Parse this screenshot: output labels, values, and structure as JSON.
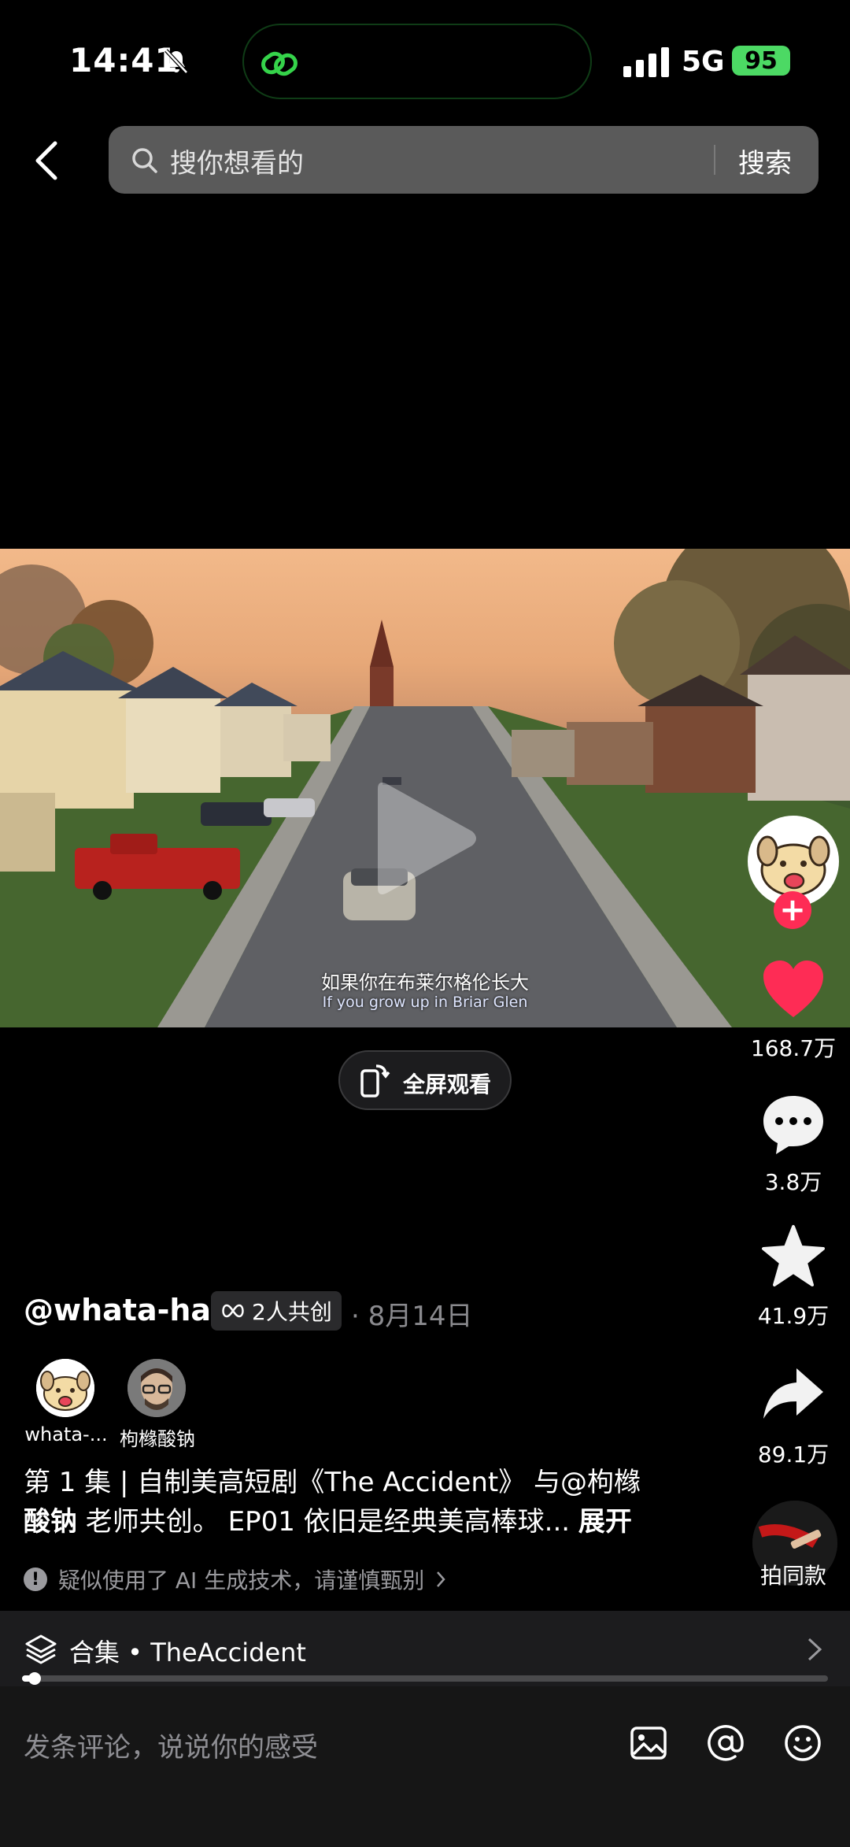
{
  "status_bar": {
    "time": "14:41",
    "network": "5G",
    "battery": "95"
  },
  "search": {
    "placeholder": "搜你想看的",
    "button": "搜索"
  },
  "video": {
    "subtitle_cn": "如果你在布莱尔格伦长大",
    "subtitle_en": "If you grow up in Briar Glen",
    "fullscreen_label": "全屏观看"
  },
  "actions": {
    "likes": "168.7万",
    "comments": "3.8万",
    "favorites": "41.9万",
    "shares": "89.1万",
    "same_style": "拍同款"
  },
  "post": {
    "handle": "@whata-ha",
    "cocreate": "2人共创",
    "date": "· 8月14日",
    "cocreators": [
      {
        "name": "whata-..."
      },
      {
        "name": "枸橼酸钠"
      }
    ],
    "desc_line1": "第 1 集 | 自制美高短剧《The Accident》 与@枸橼",
    "desc_line2_a": "酸钠",
    "desc_line2_b": " 老师共创。 EP01 依旧是经典美高棒球... ",
    "desc_more": "展开",
    "ai_notice": "疑似使用了 AI 生成技术，请谨慎甄别"
  },
  "collection": {
    "label": "合集 • TheAccident",
    "progress": 0.01
  },
  "comment": {
    "placeholder": "发条评论，说说你的感受"
  },
  "colors": {
    "accent_like": "#fe2c55",
    "battery": "#4cd964",
    "island_border": "#0f3c16"
  }
}
